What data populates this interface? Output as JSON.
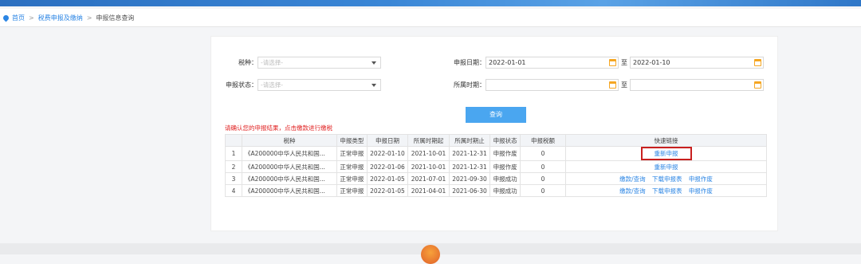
{
  "header": {
    "brand": ""
  },
  "breadcrumb": {
    "home": "首页",
    "sep1": ">",
    "level2": "税费申报及缴纳",
    "sep2": ">",
    "current": "申报信息查询"
  },
  "filters": {
    "tax_type_label": "税种：",
    "tax_type_placeholder": "-请选择-",
    "status_label": "申报状态：",
    "status_placeholder": "-请选择-",
    "report_date_label": "申报日期：",
    "report_date_from": "2022-01-01",
    "report_date_to": "2022-01-10",
    "period_label": "所属时期：",
    "period_from": "",
    "period_to": "",
    "to_label": "至",
    "query_button": "查询"
  },
  "hint": "请确认您的申报结果，点击缴款进行缴税",
  "table": {
    "headers": [
      "",
      "税种",
      "申报类型",
      "申报日期",
      "所属时期起",
      "所属时期止",
      "申报状态",
      "申报税额",
      "快速链接"
    ],
    "rows": [
      {
        "no": "1",
        "tax": "《A200000中华人民共和国...",
        "type": "正常申报",
        "date": "2022-01-10",
        "start": "2021-10-01",
        "end": "2021-12-31",
        "status": "申报作废",
        "amount": "0",
        "links": [
          "重新申报"
        ]
      },
      {
        "no": "2",
        "tax": "《A200000中华人民共和国...",
        "type": "正常申报",
        "date": "2022-01-06",
        "start": "2021-10-01",
        "end": "2021-12-31",
        "status": "申报作废",
        "amount": "0",
        "links": [
          "重新申报"
        ]
      },
      {
        "no": "3",
        "tax": "《A200000中华人民共和国...",
        "type": "正常申报",
        "date": "2022-01-05",
        "start": "2021-07-01",
        "end": "2021-09-30",
        "status": "申报成功",
        "amount": "0",
        "links": [
          "缴款/查询",
          "下载申报表",
          "申报作废"
        ]
      },
      {
        "no": "4",
        "tax": "《A200000中华人民共和国...",
        "type": "正常申报",
        "date": "2022-01-05",
        "start": "2021-04-01",
        "end": "2021-06-30",
        "status": "申报成功",
        "amount": "0",
        "links": [
          "缴款/查询",
          "下载申报表",
          "申报作废"
        ]
      }
    ]
  },
  "colors": {
    "accent": "#2b85e4",
    "button": "#4aa6f0",
    "hint": "#e02020",
    "highlight_box": "#c8201f"
  }
}
